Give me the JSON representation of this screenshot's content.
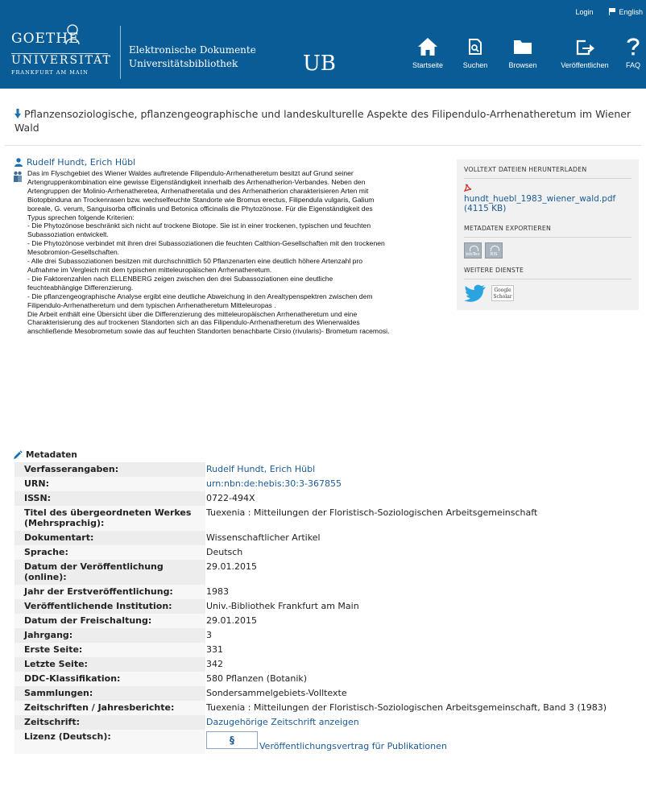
{
  "header": {
    "login_label": "Login",
    "language_label": "English",
    "logo_goethe": "GOETHE",
    "logo_universitaet": "UNIVERSITÄT",
    "logo_city": "FRANKFURT AM MAIN",
    "library_line1": "Elektronische Dokumente",
    "library_line2": "Universitätsbibliothek",
    "library_ub": "UB",
    "nav": [
      {
        "label": "Startseite",
        "icon": "home-icon"
      },
      {
        "label": "Suchen",
        "icon": "search-icon"
      },
      {
        "label": "Browsen",
        "icon": "folder-icon"
      },
      {
        "label": "Veröffentlichen",
        "icon": "publish-icon"
      },
      {
        "label": "FAQ",
        "icon": "question-icon"
      }
    ]
  },
  "document": {
    "title": "Pflanzensoziologische, pflanzengeographische und landeskulturelle Aspekte des Filipendulo-Arrhenatheretum im Wiener Wald",
    "authors": "Rudelf Hundt, Erich Hübl",
    "abstract": [
      "Das im Flyschgebiet des Wiener Waldes auftretende Filipendulo-Arrhenatheretum besitzt auf Grund seiner Artengruppenkombination eine gewisse Eigenständigkeit innerhalb des Arrhenatherion-Verbandes. Neben den Artengruppen der Molinio-Arrhenatheretea, Arrhenatheretalia und des Arrhenatherion charakterisieren Arten mit Biotopbinduna an Trockenrasen bzw. wechselfeuchte Standorte wie Bromus erectus, Filipendula vulgaris, Galium boreale, G. verum, Sanguisorba officinalis und Betonica officinalis die Phytozönose. Für die Eigenständigkeit des Typus sprechen folgende Kriterien:",
      "- Die Phytozönose beschränkt sich nicht auf trockene Biotope. Sie ist in einer trockenen, typischen und feuchten Subassoziation entwickelt.",
      "- Die Phytozönose verbindet mit ihren drei Subassoziationen die feuchten Calthion-Gesellschaften mit den trockenen Mesobromion-Gesellschaften.",
      "- Alle drei Subassoziationen besitzen mit durchschnittlich 50 Pflanzenarten eine deutlich höhere Artenzahl pro Aufnahme im Vergleich mit dem typischen mitteleuropäischen Arrhenatheretum.",
      "- Die Faktorenzahlen nach ELLENBERG zeigen zwischen den drei Subassoziationen eine deutliche feuchteabhängige Differenzierung.",
      "- Die pflanzengeographische Analyse ergibt eine deutliche Abweichung in den Arealtypenspektren zwischen dem Filipendulo-Arrhenatheretum und dem typischen Arrhenatheretum Mitteleuropas .",
      "Die Arbeit enthält eine Übersicht über die Differenzierung des mitteleuropäischen Arrhenatheretum und eine Charakterisierung des auf trockenen Standorten sich an das Filipendulo-Arrhenatheretum des Wienerwaldes anschließende Mesobrometum sowie das auf feuchten Standorten benachbarte Cirsio (rivularis)- Brometum racemosi."
    ]
  },
  "sidebar": {
    "download_heading": "VOLLTEXT DATEIEN HERUNTERLADEN",
    "pdf_name": "hundt_huebl_1983_wiener_wald.pdf",
    "pdf_size": "(4115 KB)",
    "export_heading": "METADATEN EXPORTIEREN",
    "export_buttons": [
      "bibTex",
      "RIS"
    ],
    "services_heading": "WEITERE DIENSTE",
    "scholar_line1": "Google",
    "scholar_line2": "Scholar"
  },
  "metadata": {
    "heading": "Metadaten",
    "rows": [
      {
        "label": "Verfasserangaben:",
        "value": "Rudelf Hundt, Erich Hübl",
        "link": true
      },
      {
        "label": "URN:",
        "value": "urn:nbn:de:hebis:30:3-367855",
        "link": true
      },
      {
        "label": "ISSN:",
        "value": "0722-494X",
        "link": false
      },
      {
        "label": "Titel des übergeordneten Werkes (Mehrsprachig):",
        "value": "Tuexenia : Mitteilungen der Floristisch-Soziologischen Arbeitsgemeinschaft",
        "link": false
      },
      {
        "label": "Dokumentart:",
        "value": "Wissenschaftlicher Artikel",
        "link": false
      },
      {
        "label": "Sprache:",
        "value": "Deutsch",
        "link": false
      },
      {
        "label": "Datum der Veröffentlichung (online):",
        "value": "29.01.2015",
        "link": false
      },
      {
        "label": "Jahr der Erstveröffentlichung:",
        "value": "1983",
        "link": false
      },
      {
        "label": "Veröffentlichende Institution:",
        "value": "Univ.-Bibliothek Frankfurt am Main",
        "link": false
      },
      {
        "label": "Datum der Freischaltung:",
        "value": "29.01.2015",
        "link": false
      },
      {
        "label": "Jahrgang:",
        "value": "3",
        "link": false
      },
      {
        "label": "Erste Seite:",
        "value": "331",
        "link": false
      },
      {
        "label": "Letzte Seite:",
        "value": "342",
        "link": false
      },
      {
        "label": "DDC-Klassifikation:",
        "value": "580 Pflanzen (Botanik)",
        "link": false
      },
      {
        "label": "Sammlungen:",
        "value": "Sondersammelgebiets-Volltexte",
        "link": false
      },
      {
        "label": "Zeitschriften / Jahresberichte:",
        "value": "Tuexenia : Mitteilungen der Floristisch-Soziologischen Arbeitsgemeinschaft, Band 3 (1983)",
        "link": false
      },
      {
        "label": "Zeitschrift:",
        "value": "Dazugehörige Zeitschrift anzeigen",
        "link": true
      }
    ],
    "license_label": "Lizenz (Deutsch):",
    "license_symbol": "§",
    "license_link": "Veröffentlichungsvertrag für Publikationen"
  },
  "colors": {
    "header_bg": "#0a5c96",
    "link": "#1a5a96",
    "sidebar_bg": "#f1f1f1"
  }
}
